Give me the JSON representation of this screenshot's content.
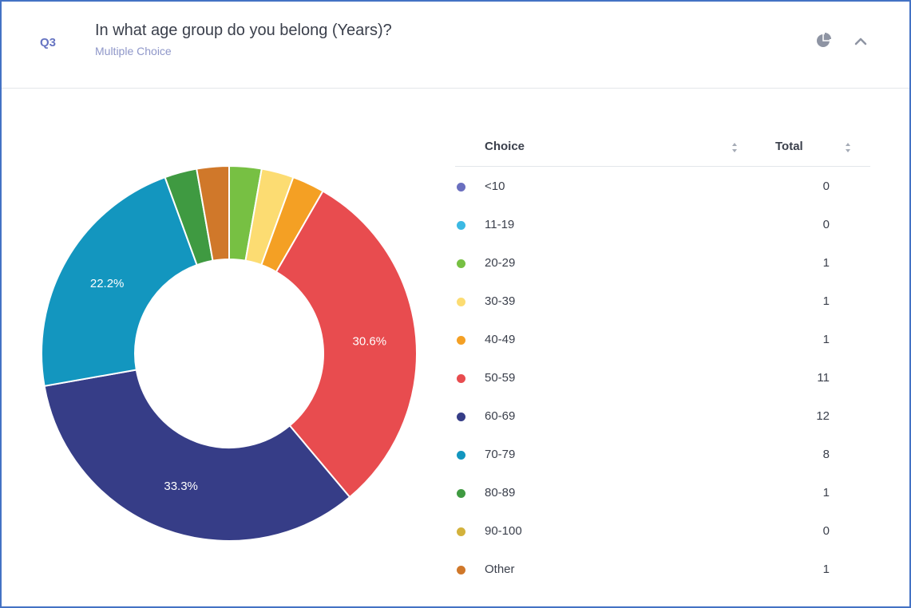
{
  "header": {
    "question_number": "Q3",
    "title": "In what age group do you belong (Years)?",
    "type": "Multiple Choice",
    "icons": [
      "pie-chart-icon",
      "chevron-up-icon"
    ]
  },
  "table": {
    "col_choice": "Choice",
    "col_total": "Total"
  },
  "colors": {
    "accent": "#6674c2",
    "frame": "#4472c4"
  },
  "chart_data": {
    "type": "pie",
    "style": "donut",
    "categories": [
      "<10",
      "11-19",
      "20-29",
      "30-39",
      "40-49",
      "50-59",
      "60-69",
      "70-79",
      "80-89",
      "90-100",
      "Other"
    ],
    "values": [
      0,
      0,
      1,
      1,
      1,
      11,
      12,
      8,
      1,
      0,
      1
    ],
    "colors": [
      "#6a6fbf",
      "#3cb9e3",
      "#77c043",
      "#fcdc72",
      "#f4a024",
      "#e84c4f",
      "#363d87",
      "#1396bf",
      "#3f9a41",
      "#d3b23c",
      "#d0782a"
    ],
    "data_labels": [
      "30.6%",
      "33.3%",
      "22.2%"
    ],
    "legend": "right-table"
  }
}
